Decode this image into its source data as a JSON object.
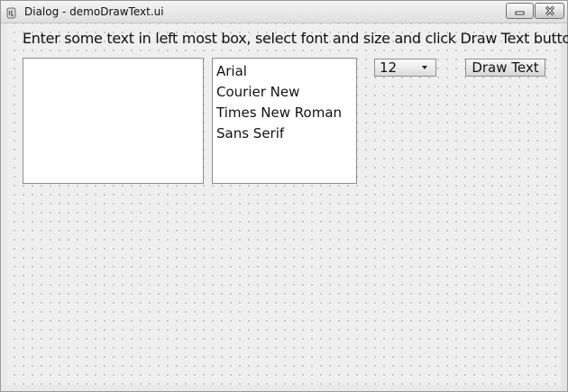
{
  "window": {
    "title": "Dialog - demoDrawText.ui"
  },
  "instruction": "Enter some text in left most box, select font and size and click Draw Text button",
  "text_input": {
    "value": ""
  },
  "font_list": {
    "items": [
      "Arial",
      "Courier New",
      "Times New Roman",
      "Sans Serif"
    ]
  },
  "size_combo": {
    "value": "12"
  },
  "draw_button": {
    "label": "Draw Text"
  }
}
